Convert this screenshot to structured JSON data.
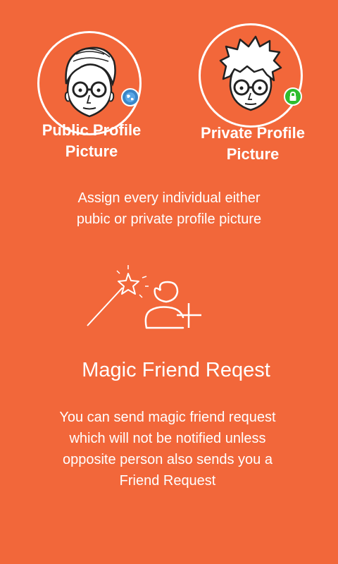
{
  "colors": {
    "background": "#F2673A",
    "foreground": "#FFFFFF",
    "public_badge": "#3A86C8",
    "private_badge": "#2EBD2E"
  },
  "public_profile": {
    "label": "Public Profile\nPicture",
    "badge_icon": "globe-icon"
  },
  "private_profile": {
    "label": "Private Profile\nPicture",
    "badge_icon": "lock-icon"
  },
  "assign_text": "Assign every individual either\npubic or private profile picture",
  "magic": {
    "icon": "magic-wand-add-friend-icon",
    "title": "Magic Friend Reqest",
    "description": "You can send magic friend request\nwhich will not be notified unless\nopposite person also sends you a\nFriend Request"
  }
}
